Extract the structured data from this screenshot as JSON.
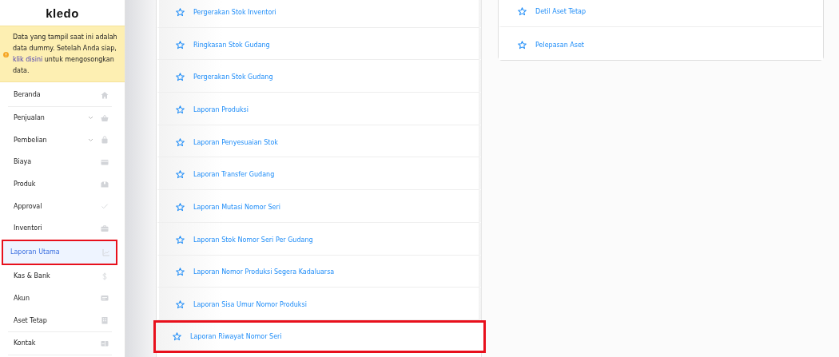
{
  "sidebar": {
    "logo": "kledo",
    "notice": {
      "text_before": "Data yang tampil saat ini adalah data dummy. Setelah Anda siap,",
      "link": "klik disini",
      "text_after": "untuk mengosongkan data."
    },
    "items": [
      {
        "label": "Beranda",
        "kind": "link",
        "selected": false,
        "highlighted": false,
        "divider_after": true
      },
      {
        "label": "Penjualan",
        "kind": "group",
        "selected": false,
        "highlighted": false,
        "divider_after": false
      },
      {
        "label": "Pembelian",
        "kind": "group",
        "selected": false,
        "highlighted": false,
        "divider_after": false
      },
      {
        "label": "Biaya",
        "kind": "link",
        "selected": false,
        "highlighted": false,
        "divider_after": false
      },
      {
        "label": "Produk",
        "kind": "link",
        "selected": false,
        "highlighted": false,
        "divider_after": false
      },
      {
        "label": "Approval",
        "kind": "link",
        "selected": false,
        "highlighted": false,
        "divider_after": false
      },
      {
        "label": "Inventori",
        "kind": "link",
        "selected": false,
        "highlighted": false,
        "divider_after": false
      },
      {
        "label": "Laporan Utama",
        "kind": "link",
        "selected": true,
        "highlighted": true,
        "divider_after": false
      },
      {
        "label": "Kas & Bank",
        "kind": "link",
        "selected": false,
        "highlighted": false,
        "divider_after": false
      },
      {
        "label": "Akun",
        "kind": "link",
        "selected": false,
        "highlighted": false,
        "divider_after": false
      },
      {
        "label": "Aset Tetap",
        "kind": "link",
        "selected": false,
        "highlighted": false,
        "divider_after": true
      },
      {
        "label": "Kontak",
        "kind": "link",
        "selected": false,
        "highlighted": false,
        "divider_after": true
      }
    ]
  },
  "reports_left": [
    {
      "label": "Pergerakan Stok Inventori",
      "highlighted": false
    },
    {
      "label": "Ringkasan Stok Gudang",
      "highlighted": false
    },
    {
      "label": "Pergerakan Stok Gudang",
      "highlighted": false
    },
    {
      "label": "Laporan Produksi",
      "highlighted": false
    },
    {
      "label": "Laporan Penyesuaian Stok",
      "highlighted": false
    },
    {
      "label": "Laporan Transfer Gudang",
      "highlighted": false
    },
    {
      "label": "Laporan Mutasi Nomor Seri",
      "highlighted": false
    },
    {
      "label": "Laporan Stok Nomor Seri Per Gudang",
      "highlighted": false
    },
    {
      "label": "Laporan Nomor Produksi Segera Kadaluarsa",
      "highlighted": false
    },
    {
      "label": "Laporan Sisa Umur Nomor Produksi",
      "highlighted": false
    },
    {
      "label": "Laporan Riwayat Nomor Seri",
      "highlighted": true
    }
  ],
  "reports_right": [
    {
      "label": "Detil Aset Tetap",
      "highlighted": false
    },
    {
      "label": "Pelepasan Aset",
      "highlighted": false
    }
  ]
}
